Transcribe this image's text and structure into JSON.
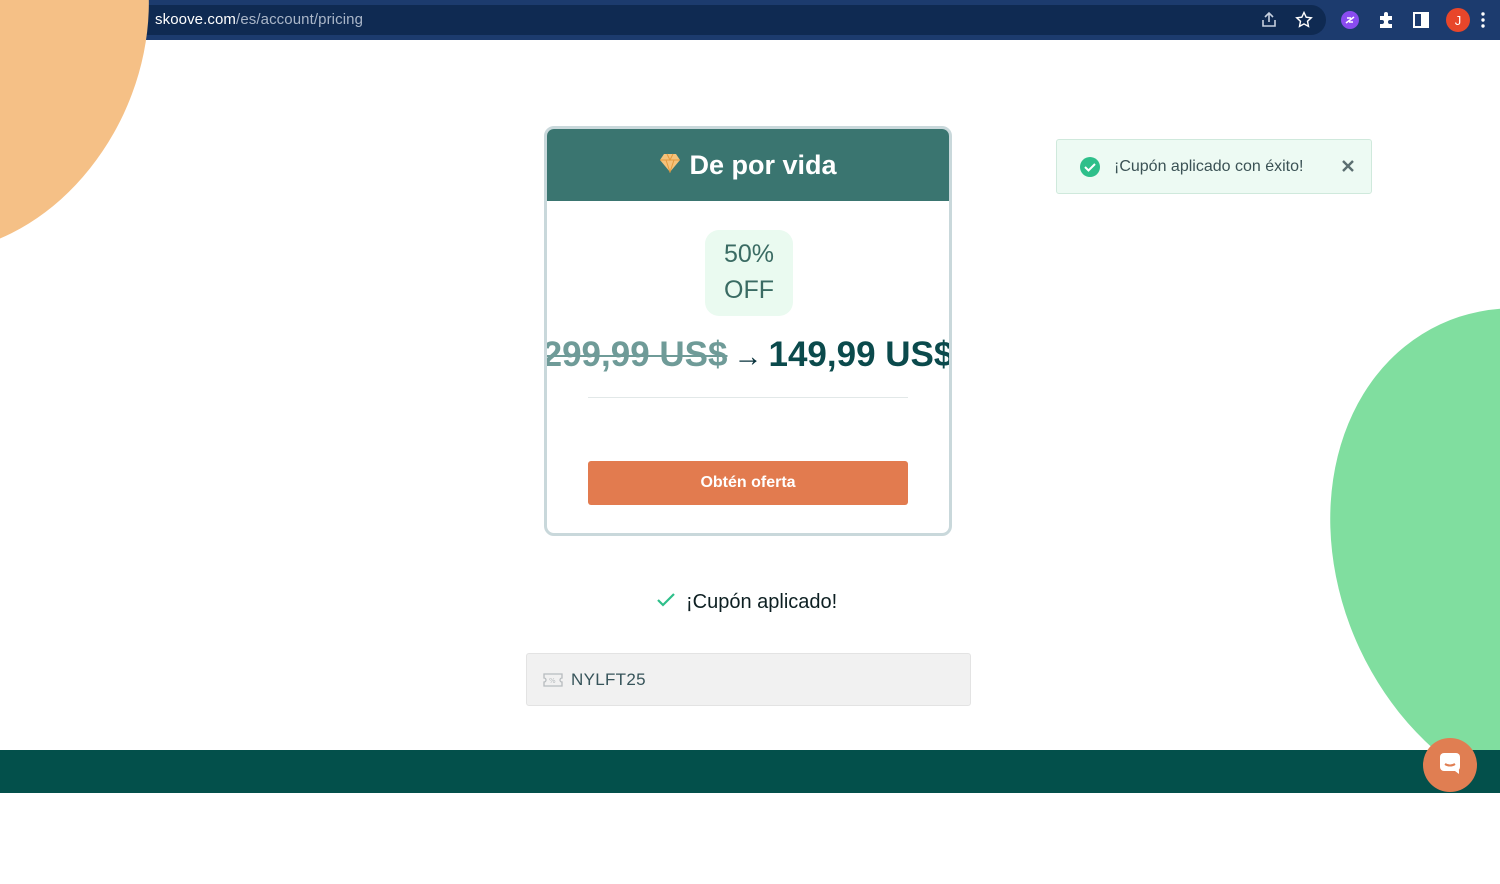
{
  "browser": {
    "url_host": "skoove.com",
    "url_path": "/es/account/pricing",
    "profile_initial": "J"
  },
  "card": {
    "title": "De por vida",
    "title_icon": "diamond-icon",
    "discount_line1": "50%",
    "discount_line2": "OFF",
    "old_price": "299,99 US$",
    "arrow": "→",
    "new_price": "149,99 US$",
    "button_label": "Obtén oferta"
  },
  "coupon": {
    "status_text": "¡Cupón aplicado!",
    "code": "NYLFT25"
  },
  "toast": {
    "message": "¡Cupón aplicado con éxito!"
  },
  "colors": {
    "header": "#3a7570",
    "button": "#e27b4f",
    "footer": "#03504b",
    "success": "#2ebf8a"
  }
}
